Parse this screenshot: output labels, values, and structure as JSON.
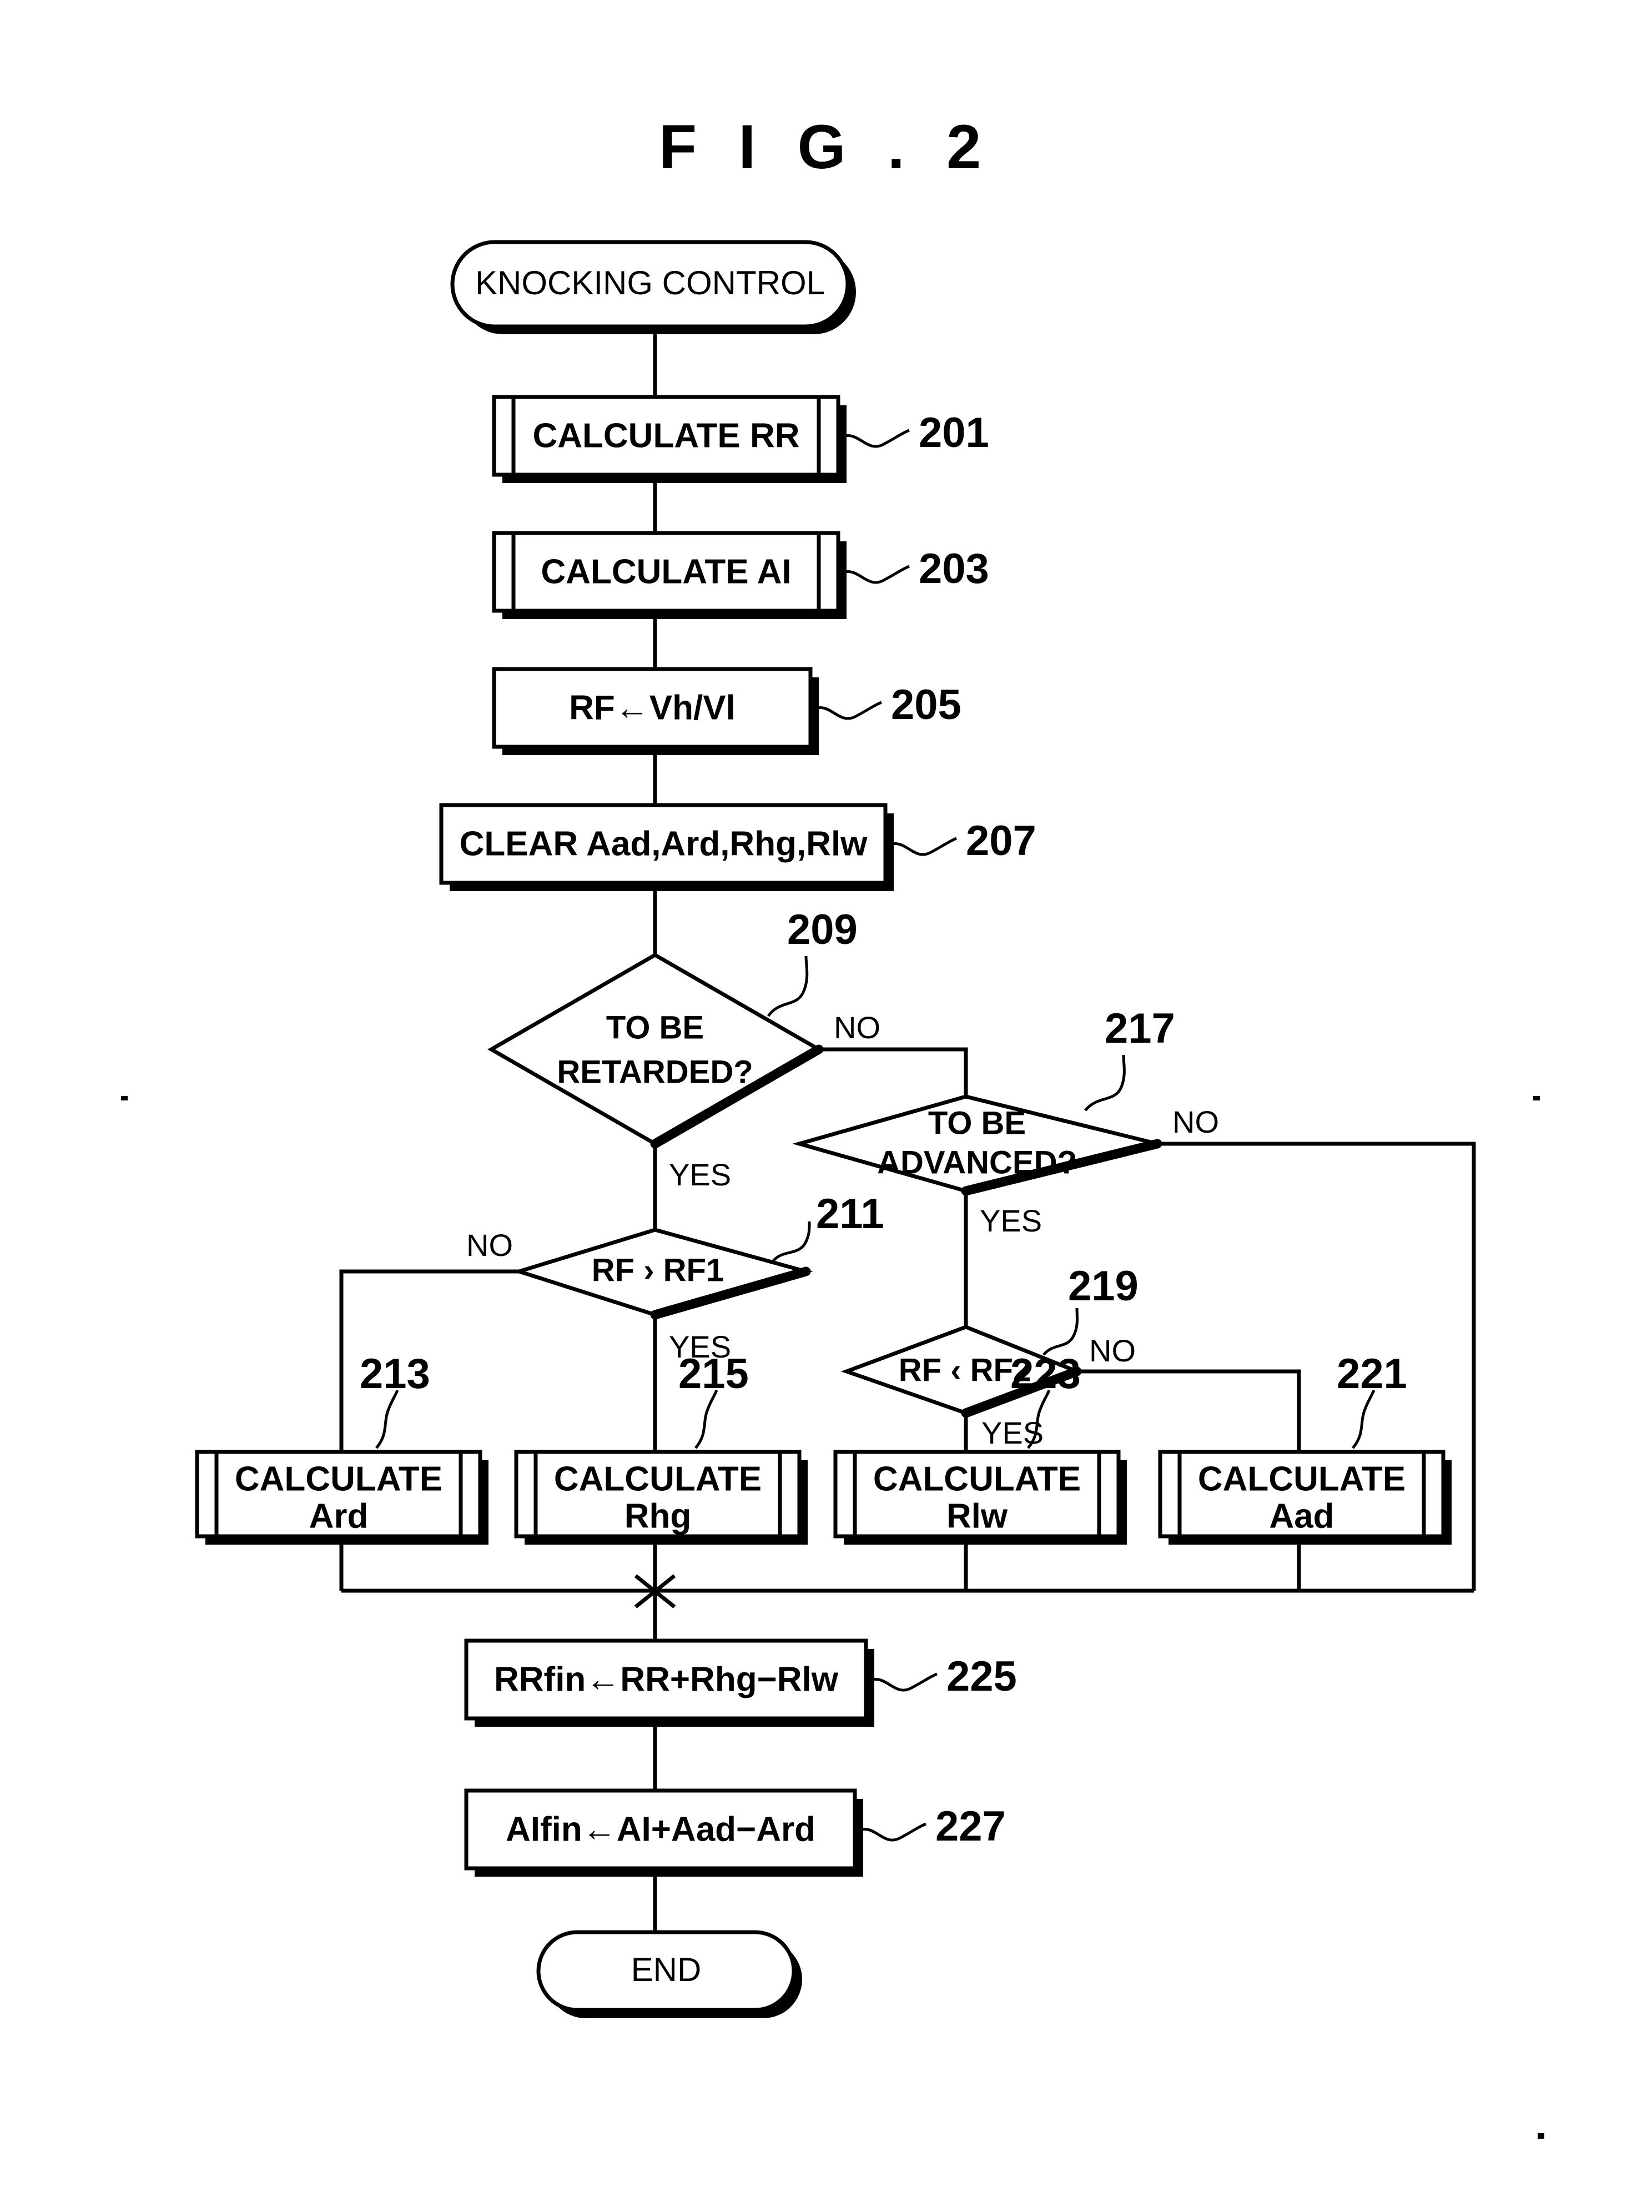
{
  "figure": {
    "title": "F I G . 2",
    "type": "patent-flowchart"
  },
  "nodes": {
    "start": {
      "label": "KNOCKING CONTROL",
      "shape": "terminator"
    },
    "n201": {
      "label": "CALCULATE RR",
      "ref": "201",
      "shape": "predefined-process"
    },
    "n203": {
      "label": "CALCULATE AI",
      "ref": "203",
      "shape": "predefined-process"
    },
    "n205": {
      "label": "RF←Vh/Vl",
      "ref": "205",
      "shape": "process"
    },
    "n207": {
      "label": "CLEAR Aad,Ard,Rhg,Rlw",
      "ref": "207",
      "shape": "process"
    },
    "n209": {
      "label_line1": "TO BE",
      "label_line2": "RETARDED?",
      "ref": "209",
      "shape": "decision",
      "yes": "YES",
      "no": "NO"
    },
    "n211": {
      "label": "RF › RF1",
      "ref": "211",
      "shape": "decision",
      "yes": "YES",
      "no": "NO"
    },
    "n213": {
      "label_line1": "CALCULATE",
      "label_line2": "Ard",
      "ref": "213",
      "shape": "predefined-process"
    },
    "n215": {
      "label_line1": "CALCULATE",
      "label_line2": "Rhg",
      "ref": "215",
      "shape": "predefined-process"
    },
    "n217": {
      "label_line1": "TO BE",
      "label_line2": "ADVANCED?",
      "ref": "217",
      "shape": "decision",
      "yes": "YES",
      "no": "NO"
    },
    "n219": {
      "label": "RF ‹ RF2",
      "ref": "219",
      "shape": "decision",
      "yes": "YES",
      "no": "NO"
    },
    "n221": {
      "label_line1": "CALCULATE",
      "label_line2": "Aad",
      "ref": "221",
      "shape": "predefined-process"
    },
    "n223": {
      "label_line1": "CALCULATE",
      "label_line2": "Rlw",
      "ref": "223",
      "shape": "predefined-process"
    },
    "n225": {
      "label": "RRfin←RR+Rhg−Rlw",
      "ref": "225",
      "shape": "process"
    },
    "n227": {
      "label": "AIfin←AI+Aad−Ard",
      "ref": "227",
      "shape": "process"
    },
    "end": {
      "label": "END",
      "shape": "terminator"
    }
  },
  "branch_labels": {
    "n209_no": "NO",
    "n209_yes": "YES",
    "n211_no": "NO",
    "n211_yes": "YES",
    "n217_no": "NO",
    "n217_yes": "YES",
    "n219_no": "NO",
    "n219_yes": "YES"
  },
  "refs": {
    "r201": "201",
    "r203": "203",
    "r205": "205",
    "r207": "207",
    "r209": "209",
    "r211": "211",
    "r213": "213",
    "r215": "215",
    "r217": "217",
    "r219": "219",
    "r221": "221",
    "r223": "223",
    "r225": "225",
    "r227": "227"
  },
  "colors": {
    "ink": "#000000",
    "paper": "#ffffff"
  }
}
